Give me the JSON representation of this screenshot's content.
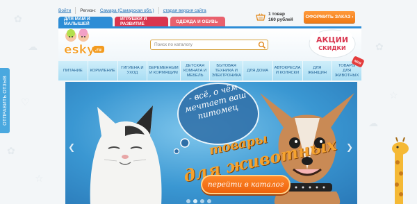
{
  "topbar": {
    "login_link": "Войти",
    "region_label": "Регион:",
    "region_value": "Самара (Самарская обл.)",
    "old_version_link": "старая версия сайта"
  },
  "cart": {
    "items": "1 товар",
    "total": "160 рублей"
  },
  "order_button": "ОФОРМИТЬ ЗАКАЗ ›",
  "category_tabs": [
    {
      "label": "ДЛЯ МАМ И МАЛЫШЕЙ"
    },
    {
      "label": "ИГРУШКИ И РАЗВИТИЕ"
    },
    {
      "label": "ОДЕЖДА И ОБУВЬ"
    }
  ],
  "logo": {
    "text": "esky",
    "suffix": ".ru"
  },
  "search": {
    "placeholder": "Поиск по каталогу"
  },
  "sale_badge": {
    "line1": "АКЦИИ",
    "line2": "СКИДКИ"
  },
  "new_badge": "NEW",
  "nav": [
    {
      "label": "ПИТАНИЕ"
    },
    {
      "label": "КОРМЛЕНИЕ"
    },
    {
      "label": "ГИГИЕНА И УХОД"
    },
    {
      "label": "БЕРЕМЕННЫМ И КОРМЯЩИМ"
    },
    {
      "label": "ДЕТСКАЯ КОМНАТА И МЕБЕЛЬ"
    },
    {
      "label": "БЫТОВАЯ ТЕХНИКА И ЭЛЕКТРОНИКА"
    },
    {
      "label": "ДЛЯ ДОМА"
    },
    {
      "label": "АВТОКРЕСЛА И КОЛЯСКИ"
    },
    {
      "label": "ДЛЯ ЖЕНЩИН"
    },
    {
      "label": "ТОВАРЫ ДЛЯ ЖИВОТНЫХ"
    }
  ],
  "side_tab": "ОТПРАВИТЬ ОТЗЫВ",
  "banner": {
    "bubble": "- всё, о чём мечтает ваш питомец",
    "promo_line1": "товары",
    "promo_line2": "для животных",
    "button": "перейти в каталог",
    "slide_count": 4,
    "active_slide": 2
  },
  "colors": {
    "brand_blue": "#2d8dd6",
    "accent_orange": "#f07a14",
    "tab_red": "#d9364f"
  }
}
